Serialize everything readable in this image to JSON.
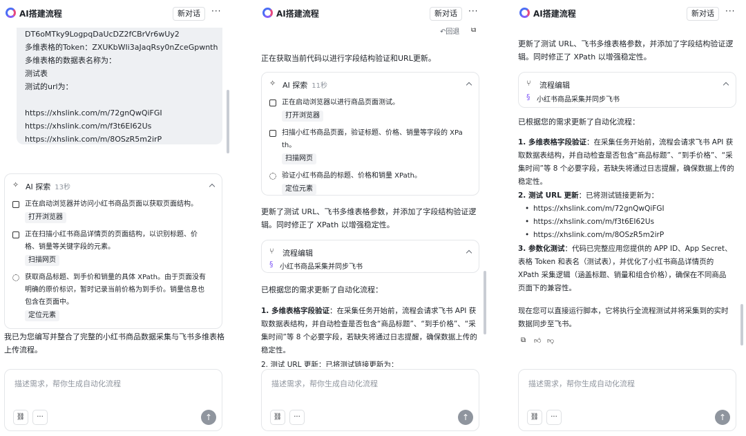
{
  "app": {
    "title": "AI搭建流程",
    "new_chat": "新对话",
    "more": "···"
  },
  "panel1": {
    "bubble_lines": [
      "DT6oMTky9LogpqDaUcDZ2fCBrVr6wUy2",
      "多维表格的Token：ZXUKbWIi3aJaqRsy0nZceGpwnth",
      "多维表格的数据表名称为：",
      "测试表",
      "测试的url为：",
      "",
      "https://xhslink.com/m/72gnQwQiFGI",
      "https://xhslink.com/m/f3t6EI62Us",
      "https://xhslink.com/m/8OSzR5m2irP"
    ],
    "explore": {
      "title": "AI 探索",
      "duration": "13秒",
      "steps": [
        {
          "text": [
            "正在启动浏览器并访问小红书商品页面以获取页面结构。"
          ],
          "tag": "打开浏览器",
          "icon": "browser-icon"
        },
        {
          "text": [
            "正在扫描小红书商品详情页的页面结构，以识别标题、价",
            "格、销量等关键字段的元素。"
          ],
          "tag": "扫描网页",
          "icon": "scan-icon"
        },
        {
          "text": [
            "获取商品标题、到手价和销量的具体 XPath。由于页面没有",
            "明确的原价标识，暂时记录当前价格为到手价。销量信息也",
            "包含在页面中。"
          ],
          "tag": "定位元素",
          "icon": "locate-icon"
        }
      ]
    },
    "summary": [
      "我已为您编写并整合了完整的小红书商品数据采集与飞书多维表格",
      "上传流程。"
    ]
  },
  "panel2": {
    "undo": "回退",
    "intro": "正在获取当前代码以进行字段结构验证和URL更新。",
    "explore": {
      "title": "AI 探索",
      "duration": "11秒",
      "steps": [
        {
          "text": [
            "正在启动浏览器以进行商品页面测试。"
          ],
          "tag": "打开浏览器",
          "icon": "browser-icon"
        },
        {
          "text": [
            "扫描小红书商品页面，验证标题、价格、销量等字段的 XPa",
            "th。"
          ],
          "tag": "扫描网页",
          "icon": "scan-icon"
        },
        {
          "text": [
            "验证小红书商品的标题、价格和销量 XPath。"
          ],
          "tag": "定位元素",
          "icon": "locate-icon"
        }
      ]
    },
    "update_text": [
      "更新了测试 URL、飞书多维表格参数，并添加了字段结构验证逻",
      "辑。同时修正了 XPath 以增强稳定性。"
    ],
    "flow_card": {
      "title": "流程编辑",
      "item": "小红书商品采集并同步飞书"
    },
    "updated": "已根据您的需求更新了自动化流程：",
    "point1_label": "1. 多维表格字段验证",
    "point1_lines": [
      "：在采集任务开始前，流程会请求飞书 API 获",
      "取数据表结构，并自动检查是否包含“商品标题”、“到手价格”、“采",
      "集时间”等 8 个必要字段，若缺失将通过日志提醒，确保数据上传的",
      "稳定性。"
    ],
    "point2_partial": "2. 测试 URL 更新：已将测试链接更新为："
  },
  "panel3": {
    "top_text": [
      "更新了测试 URL、飞书多维表格参数，并添加了字段结构验证逻",
      "辑。同时修正了 XPath 以增强稳定性。"
    ],
    "flow_card": {
      "title": "流程编辑",
      "item": "小红书商品采集并同步飞书"
    },
    "updated": "已根据您的需求更新了自动化流程：",
    "point1_label": "1. 多维表格字段验证",
    "point1_lines": [
      "：在采集任务开始前，流程会请求飞书 API 获",
      "取数据表结构，并自动检查是否包含“商品标题”、“到手价格”、“采",
      "集时间”等 8 个必要字段，若缺失将通过日志提醒，确保数据上传的",
      "稳定性。"
    ],
    "point2_label": "2. 测试 URL 更新",
    "point2_rest": "：已将测试链接更新为：",
    "urls": [
      "https://xhslink.com/m/72gnQwQiFGI",
      "https://xhslink.com/m/f3t6EI62Us",
      "https://xhslink.com/m/8OSzR5m2irP"
    ],
    "point3_label": "3. 参数化测试",
    "point3_lines": [
      "：代码已完整应用您提供的 APP ID、App Secret、",
      "表格 Token 和表名（测试表），并优化了小红书商品详情页的",
      "XPath 采集逻辑（涵盖标题、销量和组合价格），确保在不同商品",
      "页面下的兼容性。"
    ],
    "closing": [
      "现在您可以直接运行脚本，它将执行全流程测试并将采集到的实时",
      "数据同步至飞书。"
    ]
  },
  "input": {
    "placeholder": "描述需求，帮你生成自动化流程",
    "more": "···"
  }
}
